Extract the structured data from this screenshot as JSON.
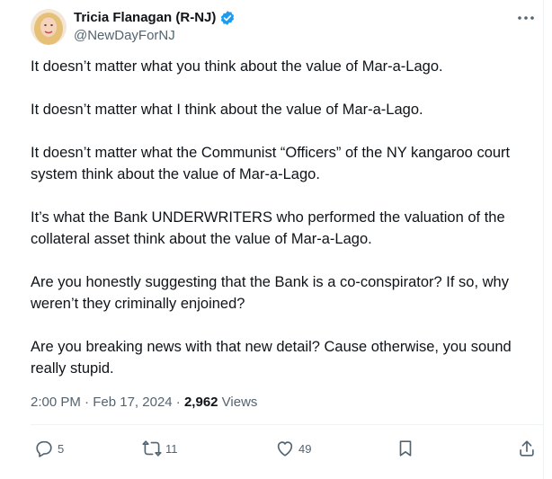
{
  "author": {
    "display_name": "Tricia Flanagan (R-NJ)",
    "handle": "@NewDayForNJ",
    "verified_icon": "verified-badge-icon"
  },
  "tweet": {
    "paragraphs": [
      "It doesn’t matter what you think about the value of Mar-a-Lago.",
      "It doesn’t matter what I think about the value of Mar-a-Lago.",
      "It doesn’t matter what the Communist “Officers” of the NY kangaroo court system think about the value of Mar-a-Lago.",
      "It’s what the Bank UNDERWRITERS who performed the valuation of the collateral asset think about the value of Mar-a-Lago.",
      "Are you honestly suggesting that the Bank is a co-conspirator?  If so, why weren’t they criminally enjoined?",
      "Are you breaking news with that new detail?  Cause otherwise, you sound really stupid."
    ]
  },
  "meta": {
    "time": "2:00 PM",
    "separator": " · ",
    "date": "Feb 17, 2024",
    "views_count": "2,962",
    "views_label": " Views"
  },
  "actions": {
    "reply_count": "5",
    "retweet_count": "11",
    "like_count": "49"
  },
  "colors": {
    "verified": "#1d9bf0",
    "secondary_text": "#536471",
    "primary_text": "#0f1419"
  }
}
